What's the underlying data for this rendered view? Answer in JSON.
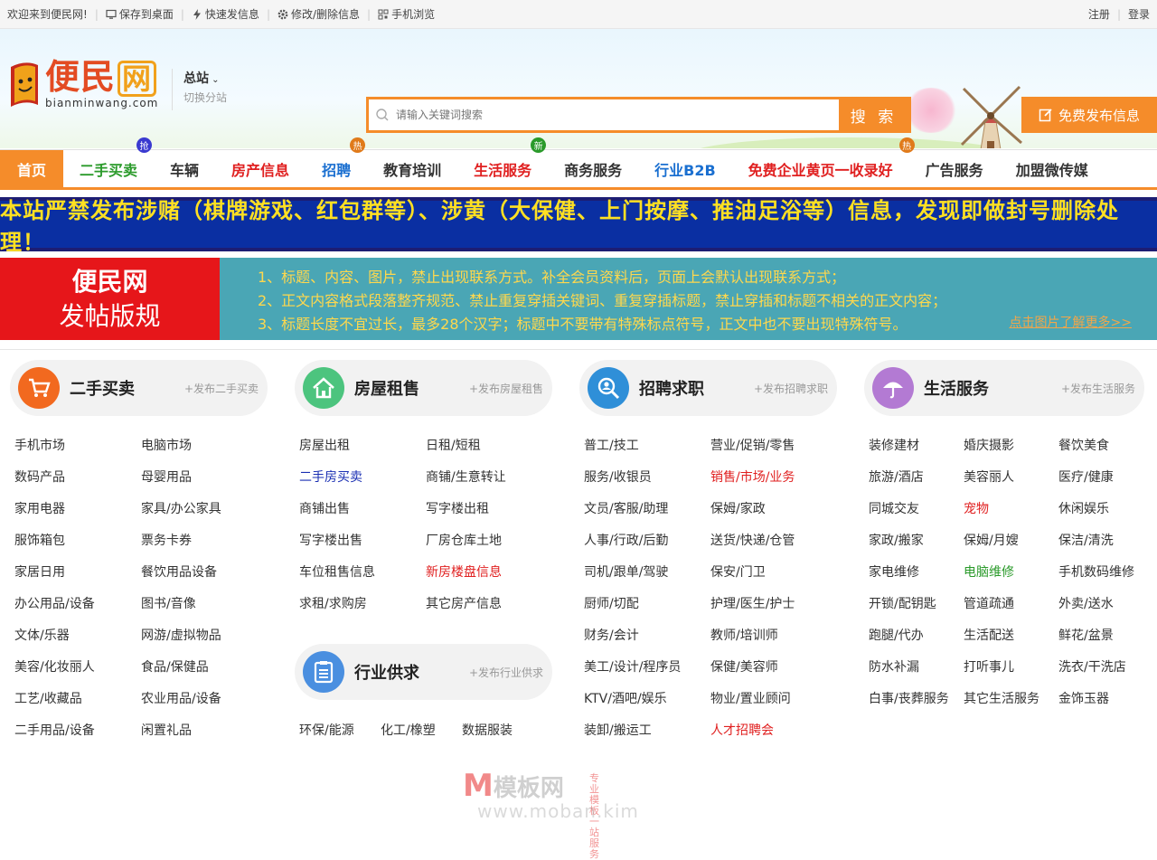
{
  "topbar": {
    "welcome": "欢迎来到便民网!",
    "links": [
      {
        "label": "保存到桌面",
        "icon": "monitor-icon"
      },
      {
        "label": "快速发信息",
        "icon": "lightning-icon"
      },
      {
        "label": "修改/删除信息",
        "icon": "gear-icon"
      },
      {
        "label": "手机浏览",
        "icon": "qrcode-icon"
      }
    ],
    "register": "注册",
    "login": "登录"
  },
  "header": {
    "logo_cn_a": "便民",
    "logo_cn_b": "网",
    "logo_en": "bianminwang.com",
    "city_current": "总站",
    "city_switch": "切换分站",
    "search_placeholder": "请输入关键词搜索",
    "search_button": "搜 索",
    "post_button": "免费发布信息"
  },
  "nav": [
    {
      "label": "首页",
      "color": "#ffffff"
    },
    {
      "label": "二手买卖",
      "color": "#2a9a2a",
      "badge": "抢",
      "badge_color": "#3a3ad0"
    },
    {
      "label": "车辆",
      "color": "#333333"
    },
    {
      "label": "房产信息",
      "color": "#e02020"
    },
    {
      "label": "招聘",
      "color": "#1a6fd0",
      "badge": "热",
      "badge_color": "#e07a1a"
    },
    {
      "label": "教育培训",
      "color": "#333333"
    },
    {
      "label": "生活服务",
      "color": "#e02020",
      "badge": "新",
      "badge_color": "#2a9a2a"
    },
    {
      "label": "商务服务",
      "color": "#333333"
    },
    {
      "label": "行业B2B",
      "color": "#1a6fd0"
    },
    {
      "label": "免费企业黄页一收录好",
      "color": "#e02020",
      "badge": "热",
      "badge_color": "#e07a1a"
    },
    {
      "label": "广告服务",
      "color": "#333333"
    },
    {
      "label": "加盟微传媒",
      "color": "#333333"
    }
  ],
  "warning": "本站严禁发布涉赌（棋牌游戏、红包群等）、涉黄（大保健、上门按摩、推油足浴等）信息，发现即做封号删除处理！",
  "rules": {
    "box_line1": "便民网",
    "box_line2": "发帖版规",
    "items": [
      "1、标题、内容、图片，禁止出现联系方式。补全会员资料后，页面上会默认出现联系方式；",
      "2、正文内容格式段落整齐规范、禁止重复穿插关键词、重复穿插标题，禁止穿插和标题不相关的正文内容；",
      "3、标题长度不宜过长，最多28个汉字；标题中不要带有特殊标点符号，正文中也不要出现特殊符号。"
    ],
    "more": "点击图片了解更多>>"
  },
  "categories": [
    {
      "title": "二手买卖",
      "add": "+发布二手买卖",
      "icon": "cart-icon",
      "color": "#f2691f"
    },
    {
      "title": "房屋租售",
      "add": "+发布房屋租售",
      "icon": "house-icon",
      "color": "#4cc47e"
    },
    {
      "title": "招聘求职",
      "add": "+发布招聘求职",
      "icon": "magnifier-person-icon",
      "color": "#2f8fd8"
    },
    {
      "title": "生活服务",
      "add": "+发布生活服务",
      "icon": "umbrella-icon",
      "color": "#b37ad3"
    },
    {
      "title": "行业供求",
      "add": "+发布行业供求",
      "icon": "list-icon",
      "color": "#4a8fe0"
    }
  ],
  "links": {
    "c1a": [
      "手机市场",
      "数码产品",
      "家用电器",
      "服饰箱包",
      "家居日用",
      "办公用品/设备",
      "文体/乐器",
      "美容/化妆丽人",
      "工艺/收藏品",
      "二手用品/设备"
    ],
    "c1b": [
      "电脑市场",
      "母婴用品",
      "家具/办公家具",
      "票务卡券",
      "餐饮用品设备",
      "图书/音像",
      "网游/虚拟物品",
      "食品/保健品",
      "农业用品/设备",
      "闲置礼品"
    ],
    "c2a": [
      "房屋出租",
      "二手房买卖",
      "商铺出售",
      "写字楼出售",
      "车位租售信息",
      "求租/求购房"
    ],
    "c2b": [
      "日租/短租",
      "商铺/生意转让",
      "写字楼出租",
      "厂房仓库土地",
      "新房楼盘信息",
      "其它房产信息"
    ],
    "c2c": [
      "环保/能源",
      "化工/橡塑",
      "数据服装"
    ],
    "c3a": [
      "普工/技工",
      "服务/收银员",
      "文员/客服/助理",
      "人事/行政/后勤",
      "司机/跟单/驾驶",
      "厨师/切配",
      "财务/会计",
      "美工/设计/程序员",
      "KTV/酒吧/娱乐",
      "装卸/搬运工"
    ],
    "c3b": [
      "营业/促销/零售",
      "销售/市场/业务",
      "保姆/家政",
      "送货/快递/仓管",
      "保安/门卫",
      "护理/医生/护士",
      "教师/培训师",
      "保健/美容师",
      "物业/置业顾问",
      "人才招聘会"
    ],
    "c4a": [
      "装修建材",
      "旅游/酒店",
      "同城交友",
      "家政/搬家",
      "家电维修",
      "开锁/配钥匙",
      "跑腿/代办",
      "防水补漏",
      "白事/丧葬服务"
    ],
    "c4b": [
      "婚庆摄影",
      "美容丽人",
      "宠物",
      "保姆/月嫂",
      "电脑维修",
      "管道疏通",
      "生活配送",
      "打听事儿",
      "其它生活服务"
    ],
    "c4c": [
      "餐饮美食",
      "医疗/健康",
      "休闲娱乐",
      "保洁/清洗",
      "手机数码维修",
      "外卖/送水",
      "鲜花/盆景",
      "洗衣/干洗店",
      "金饰玉器"
    ]
  },
  "watermark": {
    "m": "M",
    "text": "模板网",
    "tag1": "专业模板",
    "tag2": "一站服务",
    "url": "www.moban.kim"
  },
  "colors": {
    "accent": "#f58c2a",
    "warning_bg": "#0a2fa2",
    "warning_text": "#ffe022",
    "rules_bg": "#4aa6b5",
    "rules_box": "#e6161a"
  }
}
